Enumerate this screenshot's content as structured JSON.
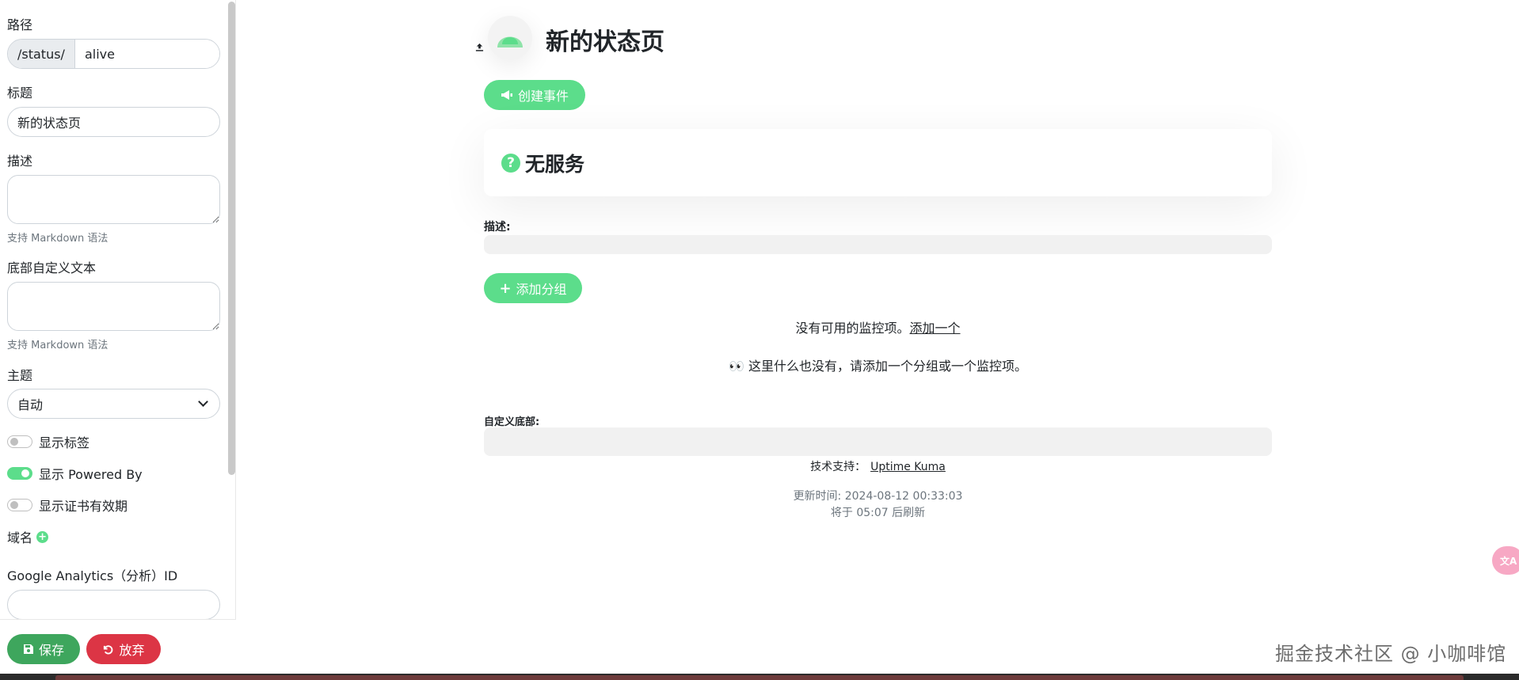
{
  "sidebar": {
    "path_label": "路径",
    "path_prefix": "/status/",
    "path_value": "alive",
    "title_label": "标题",
    "title_value": "新的状态页",
    "description_label": "描述",
    "description_hint": "支持 Markdown 语法",
    "footer_text_label": "底部自定义文本",
    "footer_text_hint": "支持 Markdown 语法",
    "theme_label": "主题",
    "theme_value": "自动",
    "toggles": [
      {
        "label": "显示标签",
        "on": false
      },
      {
        "label": "显示 Powered By",
        "on": true
      },
      {
        "label": "显示证书有效期",
        "on": false
      }
    ],
    "domain_label": "域名",
    "ga_label": "Google Analytics（分析）ID",
    "save_label": "保存",
    "discard_label": "放弃"
  },
  "main": {
    "page_title": "新的状态页",
    "create_incident_label": "创建事件",
    "no_service_title": "无服务",
    "description_heading": "描述:",
    "add_group_label": "添加分组",
    "no_monitors_text": "没有可用的监控项。",
    "add_one_link": "添加一个",
    "empty_text": "👀 这里什么也没有，请添加一个分组或一个监控项。",
    "custom_footer_heading": "自定义底部:",
    "powered_by_label": "技术支持：",
    "powered_by_link": "Uptime Kuma",
    "updated_text": "更新时间: 2024-08-12 00:33:03",
    "refresh_text": "将于 05:07 后刷新"
  },
  "watermark": "掘金技术社区 @ 小咖啡馆",
  "colors": {
    "accent_green": "#5cdd8b",
    "save_green": "#3ea65d",
    "danger_red": "#dc3545"
  }
}
